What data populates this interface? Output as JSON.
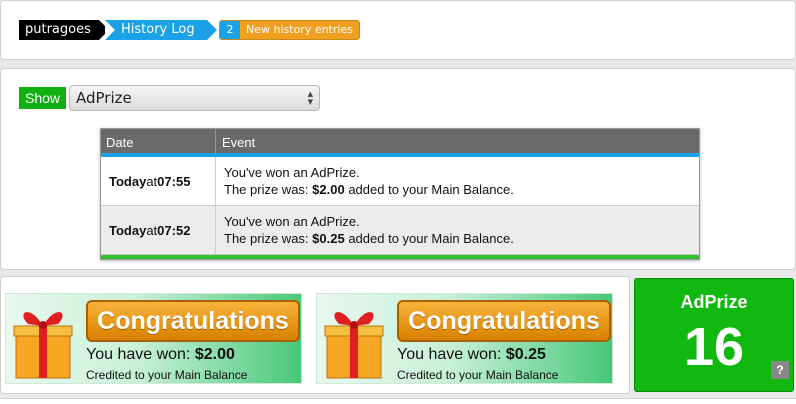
{
  "breadcrumb": {
    "user": "putragoes",
    "page": "History Log"
  },
  "notification": {
    "count": "2",
    "label": "New history entries"
  },
  "filter": {
    "show_label": "Show",
    "selected": "AdPrize"
  },
  "table": {
    "headers": {
      "date": "Date",
      "event": "Event"
    },
    "rows": [
      {
        "date_bold": "Today",
        "date_mid": " at ",
        "time": "07:55",
        "line1": "You've won an AdPrize.",
        "prize_prefix": "The prize was: ",
        "amount": "$2.00",
        "prize_suffix": " added to your Main Balance."
      },
      {
        "date_bold": "Today",
        "date_mid": " at ",
        "time": "07:52",
        "line1": "You've won an AdPrize.",
        "prize_prefix": "The prize was: ",
        "amount": "$0.25",
        "prize_suffix": " added to your Main Balance."
      }
    ]
  },
  "banners": [
    {
      "title": "Congratulations",
      "won_prefix": "You have won: ",
      "amount": "$2.00",
      "credited": "Credited to your Main Balance"
    },
    {
      "title": "Congratulations",
      "won_prefix": "You have won: ",
      "amount": "$0.25",
      "credited": "Credited to your Main Balance"
    }
  ],
  "adprize_box": {
    "title": "AdPrize",
    "count": "16",
    "help": "?"
  },
  "colors": {
    "accent_blue": "#1aa1e8",
    "accent_green": "#10b810",
    "accent_orange": "#f0a020"
  },
  "icons": [
    "gift-icon",
    "select-arrows-icon",
    "help-icon"
  ]
}
